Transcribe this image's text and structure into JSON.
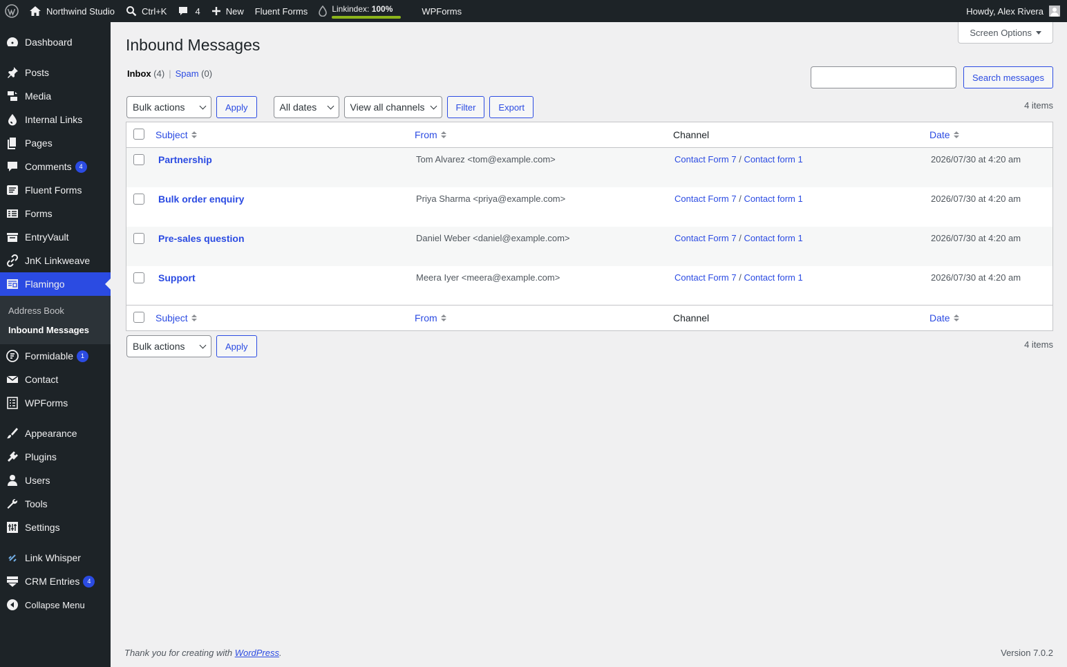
{
  "admin_bar": {
    "site_name": "Northwind Studio",
    "search_shortcut": "Ctrl+K",
    "comments_count": "4",
    "new_label": "New",
    "fluent_forms": "Fluent Forms",
    "linkindex_label": "Linkindex:",
    "linkindex_value": "100%",
    "linkindex_progress": 1.0,
    "wpforms": "WPForms",
    "howdy": "Howdy, Alex Rivera"
  },
  "sidebar": {
    "items": [
      {
        "label": "Dashboard",
        "icon": "dashboard-icon"
      },
      {
        "label": "Posts",
        "icon": "pin-icon"
      },
      {
        "label": "Media",
        "icon": "media-icon"
      },
      {
        "label": "Internal Links",
        "icon": "drop-icon"
      },
      {
        "label": "Pages",
        "icon": "pages-icon"
      },
      {
        "label": "Comments",
        "icon": "comment-icon",
        "badge": "4"
      },
      {
        "label": "Fluent Forms",
        "icon": "fluent-forms-icon"
      },
      {
        "label": "Forms",
        "icon": "forms-icon"
      },
      {
        "label": "EntryVault",
        "icon": "entryvault-icon"
      },
      {
        "label": "JnK Linkweave",
        "icon": "link-icon"
      },
      {
        "label": "Flamingo",
        "icon": "flamingo-icon"
      },
      {
        "label": "Formidable",
        "icon": "formidable-icon",
        "badge": "1"
      },
      {
        "label": "Contact",
        "icon": "mail-icon"
      },
      {
        "label": "WPForms",
        "icon": "wpforms-icon"
      },
      {
        "label": "Appearance",
        "icon": "brush-icon"
      },
      {
        "label": "Plugins",
        "icon": "plugin-icon"
      },
      {
        "label": "Users",
        "icon": "user-icon"
      },
      {
        "label": "Tools",
        "icon": "wrench-icon"
      },
      {
        "label": "Settings",
        "icon": "settings-icon"
      },
      {
        "label": "Link Whisper",
        "icon": "link-whisper-icon"
      },
      {
        "label": "CRM Entries",
        "icon": "crm-icon",
        "badge": "4"
      },
      {
        "label": "Collapse Menu",
        "icon": "collapse-icon"
      }
    ],
    "submenu": [
      "Address Book",
      "Inbound Messages"
    ]
  },
  "main": {
    "screen_options": "Screen Options",
    "title": "Inbound Messages",
    "views": {
      "inbox": "Inbox",
      "inbox_count": "(4)",
      "spam": "Spam",
      "spam_count": "(0)",
      "separator": "|"
    },
    "search_button": "Search messages",
    "search_value": "",
    "bulk_actions": "Bulk actions",
    "apply": "Apply",
    "all_dates": "All dates",
    "channels": "View all channels",
    "filter": "Filter",
    "export": "Export",
    "items_count": "4 items",
    "columns": {
      "subject": "Subject",
      "from": "From",
      "channel": "Channel",
      "date": "Date"
    },
    "rows": [
      {
        "subject": "Partnership",
        "from": "Tom Alvarez <tom@example.com>",
        "channel_a": "Contact Form 7",
        "channel_sep": " / ",
        "channel_b": "Contact form 1",
        "date": "2026/07/30 at 4:20 am"
      },
      {
        "subject": "Bulk order enquiry",
        "from": "Priya Sharma <priya@example.com>",
        "channel_a": "Contact Form 7",
        "channel_sep": " / ",
        "channel_b": "Contact form 1",
        "date": "2026/07/30 at 4:20 am"
      },
      {
        "subject": "Pre-sales question",
        "from": "Daniel Weber <daniel@example.com>",
        "channel_a": "Contact Form 7",
        "channel_sep": " / ",
        "channel_b": "Contact form 1",
        "date": "2026/07/30 at 4:20 am"
      },
      {
        "subject": "Support",
        "from": "Meera Iyer <meera@example.com>",
        "channel_a": "Contact Form 7",
        "channel_sep": " / ",
        "channel_b": "Contact form 1",
        "date": "2026/07/30 at 4:20 am"
      }
    ]
  },
  "footer": {
    "thanks_prefix": "Thank you for creating with ",
    "thanks_link": "WordPress",
    "thanks_suffix": ".",
    "version": "Version 7.0.2"
  },
  "colors": {
    "accent": "#2b4be2",
    "admin_bg": "#1d2327",
    "linkindex_bar": "#8cb51b"
  }
}
